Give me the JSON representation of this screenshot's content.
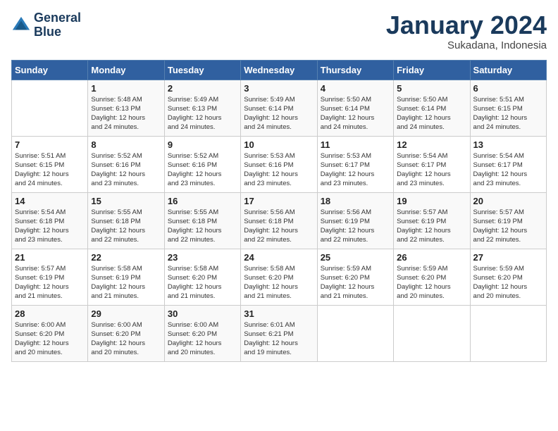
{
  "header": {
    "logo_line1": "General",
    "logo_line2": "Blue",
    "month": "January 2024",
    "location": "Sukadana, Indonesia"
  },
  "days_of_week": [
    "Sunday",
    "Monday",
    "Tuesday",
    "Wednesday",
    "Thursday",
    "Friday",
    "Saturday"
  ],
  "weeks": [
    [
      {
        "day": "",
        "info": ""
      },
      {
        "day": "1",
        "info": "Sunrise: 5:48 AM\nSunset: 6:13 PM\nDaylight: 12 hours\nand 24 minutes."
      },
      {
        "day": "2",
        "info": "Sunrise: 5:49 AM\nSunset: 6:13 PM\nDaylight: 12 hours\nand 24 minutes."
      },
      {
        "day": "3",
        "info": "Sunrise: 5:49 AM\nSunset: 6:14 PM\nDaylight: 12 hours\nand 24 minutes."
      },
      {
        "day": "4",
        "info": "Sunrise: 5:50 AM\nSunset: 6:14 PM\nDaylight: 12 hours\nand 24 minutes."
      },
      {
        "day": "5",
        "info": "Sunrise: 5:50 AM\nSunset: 6:14 PM\nDaylight: 12 hours\nand 24 minutes."
      },
      {
        "day": "6",
        "info": "Sunrise: 5:51 AM\nSunset: 6:15 PM\nDaylight: 12 hours\nand 24 minutes."
      }
    ],
    [
      {
        "day": "7",
        "info": "Sunrise: 5:51 AM\nSunset: 6:15 PM\nDaylight: 12 hours\nand 24 minutes."
      },
      {
        "day": "8",
        "info": "Sunrise: 5:52 AM\nSunset: 6:16 PM\nDaylight: 12 hours\nand 23 minutes."
      },
      {
        "day": "9",
        "info": "Sunrise: 5:52 AM\nSunset: 6:16 PM\nDaylight: 12 hours\nand 23 minutes."
      },
      {
        "day": "10",
        "info": "Sunrise: 5:53 AM\nSunset: 6:16 PM\nDaylight: 12 hours\nand 23 minutes."
      },
      {
        "day": "11",
        "info": "Sunrise: 5:53 AM\nSunset: 6:17 PM\nDaylight: 12 hours\nand 23 minutes."
      },
      {
        "day": "12",
        "info": "Sunrise: 5:54 AM\nSunset: 6:17 PM\nDaylight: 12 hours\nand 23 minutes."
      },
      {
        "day": "13",
        "info": "Sunrise: 5:54 AM\nSunset: 6:17 PM\nDaylight: 12 hours\nand 23 minutes."
      }
    ],
    [
      {
        "day": "14",
        "info": "Sunrise: 5:54 AM\nSunset: 6:18 PM\nDaylight: 12 hours\nand 23 minutes."
      },
      {
        "day": "15",
        "info": "Sunrise: 5:55 AM\nSunset: 6:18 PM\nDaylight: 12 hours\nand 22 minutes."
      },
      {
        "day": "16",
        "info": "Sunrise: 5:55 AM\nSunset: 6:18 PM\nDaylight: 12 hours\nand 22 minutes."
      },
      {
        "day": "17",
        "info": "Sunrise: 5:56 AM\nSunset: 6:18 PM\nDaylight: 12 hours\nand 22 minutes."
      },
      {
        "day": "18",
        "info": "Sunrise: 5:56 AM\nSunset: 6:19 PM\nDaylight: 12 hours\nand 22 minutes."
      },
      {
        "day": "19",
        "info": "Sunrise: 5:57 AM\nSunset: 6:19 PM\nDaylight: 12 hours\nand 22 minutes."
      },
      {
        "day": "20",
        "info": "Sunrise: 5:57 AM\nSunset: 6:19 PM\nDaylight: 12 hours\nand 22 minutes."
      }
    ],
    [
      {
        "day": "21",
        "info": "Sunrise: 5:57 AM\nSunset: 6:19 PM\nDaylight: 12 hours\nand 21 minutes."
      },
      {
        "day": "22",
        "info": "Sunrise: 5:58 AM\nSunset: 6:19 PM\nDaylight: 12 hours\nand 21 minutes."
      },
      {
        "day": "23",
        "info": "Sunrise: 5:58 AM\nSunset: 6:20 PM\nDaylight: 12 hours\nand 21 minutes."
      },
      {
        "day": "24",
        "info": "Sunrise: 5:58 AM\nSunset: 6:20 PM\nDaylight: 12 hours\nand 21 minutes."
      },
      {
        "day": "25",
        "info": "Sunrise: 5:59 AM\nSunset: 6:20 PM\nDaylight: 12 hours\nand 21 minutes."
      },
      {
        "day": "26",
        "info": "Sunrise: 5:59 AM\nSunset: 6:20 PM\nDaylight: 12 hours\nand 20 minutes."
      },
      {
        "day": "27",
        "info": "Sunrise: 5:59 AM\nSunset: 6:20 PM\nDaylight: 12 hours\nand 20 minutes."
      }
    ],
    [
      {
        "day": "28",
        "info": "Sunrise: 6:00 AM\nSunset: 6:20 PM\nDaylight: 12 hours\nand 20 minutes."
      },
      {
        "day": "29",
        "info": "Sunrise: 6:00 AM\nSunset: 6:20 PM\nDaylight: 12 hours\nand 20 minutes."
      },
      {
        "day": "30",
        "info": "Sunrise: 6:00 AM\nSunset: 6:20 PM\nDaylight: 12 hours\nand 20 minutes."
      },
      {
        "day": "31",
        "info": "Sunrise: 6:01 AM\nSunset: 6:21 PM\nDaylight: 12 hours\nand 19 minutes."
      },
      {
        "day": "",
        "info": ""
      },
      {
        "day": "",
        "info": ""
      },
      {
        "day": "",
        "info": ""
      }
    ]
  ]
}
